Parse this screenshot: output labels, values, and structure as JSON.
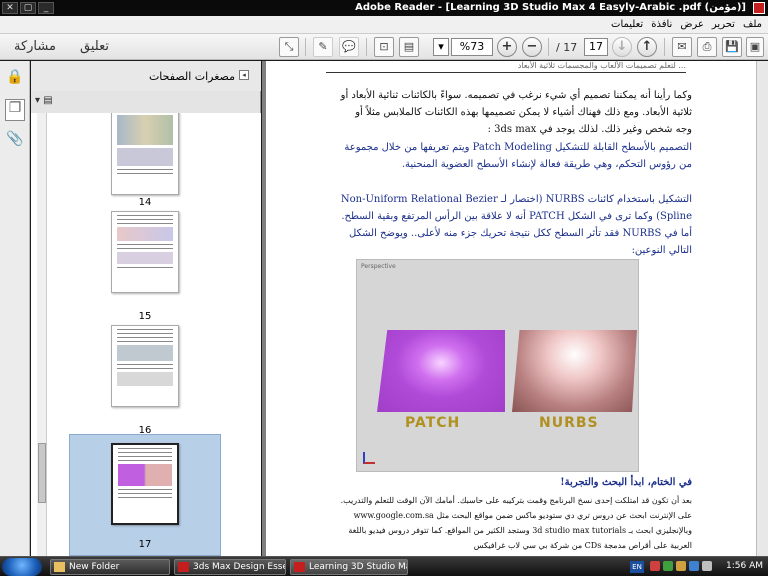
{
  "window": {
    "title": "Adobe Reader - [Learning 3D Studio Max 4 Easyly-Arabic .pdf (مؤمن)]",
    "buttons": [
      "✕",
      "▢",
      "_"
    ]
  },
  "menu": {
    "items": [
      "ملف",
      "تحرير",
      "عرض",
      "نافذة",
      "تعليمات"
    ]
  },
  "toolbar": {
    "share_label": "مشاركة",
    "comment_label": "تعليق",
    "page_current": "17",
    "page_total": "/ 17",
    "zoom": "%73",
    "plus": "+",
    "minus": "−"
  },
  "panel": {
    "title": "مصغرات الصفحات",
    "thumbnails": [
      {
        "label": "14",
        "selected": false
      },
      {
        "label": "15",
        "selected": false
      },
      {
        "label": "16",
        "selected": false
      },
      {
        "label": "17",
        "selected": true
      }
    ]
  },
  "page": {
    "header": "... لتعلم تصميمات الألعاب والمجسمات ثلاثية الأبعاد",
    "intro": "وكما رأينا أنه يمكننا تصميم أي شيء نرغب في تصميمه. سواءً بالكائنات ثنائية الأبعاد أو ثلاثية الأبعاد. ومع ذلك فهناك أشياء لا يمكن تصميمها بهذه الكائنات كالملابس مثلاً أو وجه شخص وغير ذلك. لذلك يوجد في 3ds max :",
    "bullet1": "التصميم بالأسطح القابلة للتشكيل Patch Modeling ويتم تعريفها من خلال مجموعة من رؤوس التحكم، وهي طريقة فعالة لإنشاء الأسطح العضوية المنحنية.",
    "bullet2": "التشكيل باستخدام كائنات NURBS (اختصار لـ Non-Uniform Relational Bezier Spline) وكما ترى في الشكل PATCH أنه لا علاقة بين الرأس المرتفع وبقية السطح. أما في NURBS فقد تأثر السطح ككل نتيجة تحريك جزء منه لأعلى.. ويوضح الشكل التالي النوعين:",
    "figure_label": "Perspective",
    "caption_patch": "PATCH",
    "caption_nurbs": "NURBS",
    "section_title": "في الختام، ابدأ البحث والتجربة!",
    "closing": "بعد أن تكون قد امتلكت إحدى نسخ البرنامج وقمت بتركيبه على حاسبك. أمامك الآن الوقت للتعلم والتدريب. على الإنترنت ابحث عن دروس تري دي ستوديو ماكس ضمن مواقع البحث مثل www.google.com.sa وبالإنجليزي ابحث بـ 3d studio max tutorials وستجد الكثير من المواقع. كما تتوفر دروس فيديو باللغة العربية على أقراص مدمجة CDs من شركة بي سي لاب غرافيكس"
  },
  "taskbar": {
    "tasks": [
      "New Folder",
      "3ds Max Design Essen...",
      "Learning 3D Studio Ma..."
    ],
    "lang": "EN",
    "clock": "1:56 AM"
  },
  "colors": {
    "accent_blue": "#1a2e8a",
    "caption_gold": "#b09020",
    "selection": "#b8cfe8"
  }
}
